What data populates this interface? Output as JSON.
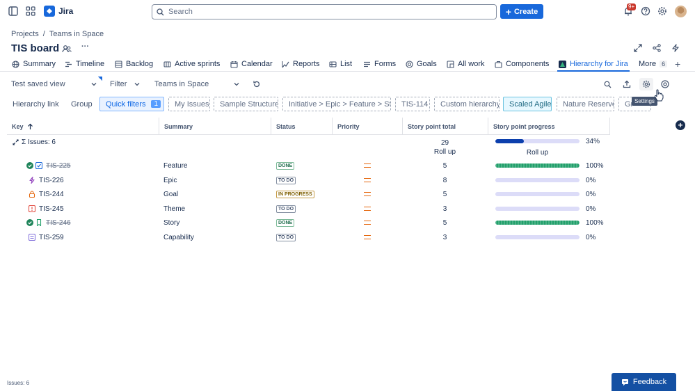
{
  "topbar": {
    "app_name": "Jira",
    "search_placeholder": "Search",
    "create_label": "Create",
    "notifications_badge": "9+"
  },
  "breadcrumb": {
    "root": "Projects",
    "separator": "/",
    "project": "Teams in Space"
  },
  "board": {
    "title": "TIS board",
    "more": "···"
  },
  "tabs": [
    {
      "label": "Summary",
      "icon": "globe-icon"
    },
    {
      "label": "Timeline",
      "icon": "timeline-icon"
    },
    {
      "label": "Backlog",
      "icon": "backlog-icon"
    },
    {
      "label": "Active sprints",
      "icon": "board-icon"
    },
    {
      "label": "Calendar",
      "icon": "calendar-icon"
    },
    {
      "label": "Reports",
      "icon": "chart-icon"
    },
    {
      "label": "List",
      "icon": "list-icon"
    },
    {
      "label": "Forms",
      "icon": "forms-icon"
    },
    {
      "label": "Goals",
      "icon": "goals-icon"
    },
    {
      "label": "All work",
      "icon": "all-work-icon"
    },
    {
      "label": "Components",
      "icon": "components-icon"
    },
    {
      "label": "Hierarchy for Jira",
      "icon": "hierarchy-app-icon",
      "active": true
    }
  ],
  "tabs_more": {
    "label": "More",
    "count": "6"
  },
  "toolbar": {
    "saved_view": "Test saved view",
    "filter": "Filter",
    "team": "Teams in Space",
    "tooltip": "Settings"
  },
  "filter_row": {
    "hierarchy_link": "Hierarchy link",
    "group": "Group",
    "quick_filters": "Quick filters",
    "quick_filters_count": "1",
    "chips": [
      "My Issues",
      "Sample Structure",
      "Initiative > Epic > Feature > St...",
      "TIS-114",
      "Custom hierarchy",
      "Scaled Agile",
      "Nature Reserve",
      "Gr"
    ]
  },
  "table": {
    "headers": [
      "Key",
      "Summary",
      "Status",
      "Priority",
      "Story point total",
      "Story point progress"
    ],
    "summary_row": {
      "label": "Σ Issues: 6",
      "total": "29",
      "total_sub": "Roll up",
      "progress_pct": "34%",
      "progress_value": 0.34,
      "progress_sub": "Roll up"
    },
    "rows": [
      {
        "key": "TIS-225",
        "summary": "Feature",
        "status": "DONE",
        "points": "5",
        "pct": "100%",
        "progress": 1.0,
        "done": true,
        "type_icon": "feature-icon"
      },
      {
        "key": "TIS-226",
        "summary": "Epic",
        "status": "TO DO",
        "points": "8",
        "pct": "0%",
        "progress": 0,
        "done": false,
        "type_icon": "epic-icon"
      },
      {
        "key": "TIS-244",
        "summary": "Goal",
        "status": "IN PROGRESS",
        "points": "5",
        "pct": "0%",
        "progress": 0,
        "done": false,
        "type_icon": "goal-icon"
      },
      {
        "key": "TIS-245",
        "summary": "Theme",
        "status": "TO DO",
        "points": "3",
        "pct": "0%",
        "progress": 0,
        "done": false,
        "type_icon": "theme-icon"
      },
      {
        "key": "TIS-246",
        "summary": "Story",
        "status": "DONE",
        "points": "5",
        "pct": "100%",
        "progress": 1.0,
        "done": true,
        "type_icon": "story-icon"
      },
      {
        "key": "TIS-259",
        "summary": "Capability",
        "status": "TO DO",
        "points": "3",
        "pct": "0%",
        "progress": 0,
        "done": false,
        "type_icon": "capability-icon"
      }
    ]
  },
  "footer": {
    "issues_count": "Issues: 6",
    "feedback": "Feedback"
  },
  "colors": {
    "accent": "#1868db",
    "progress_done": "#22a06b",
    "progress_partial": "#0c3fad",
    "progress_track": "#dcdcf8",
    "priority_medium": "#e56910"
  }
}
